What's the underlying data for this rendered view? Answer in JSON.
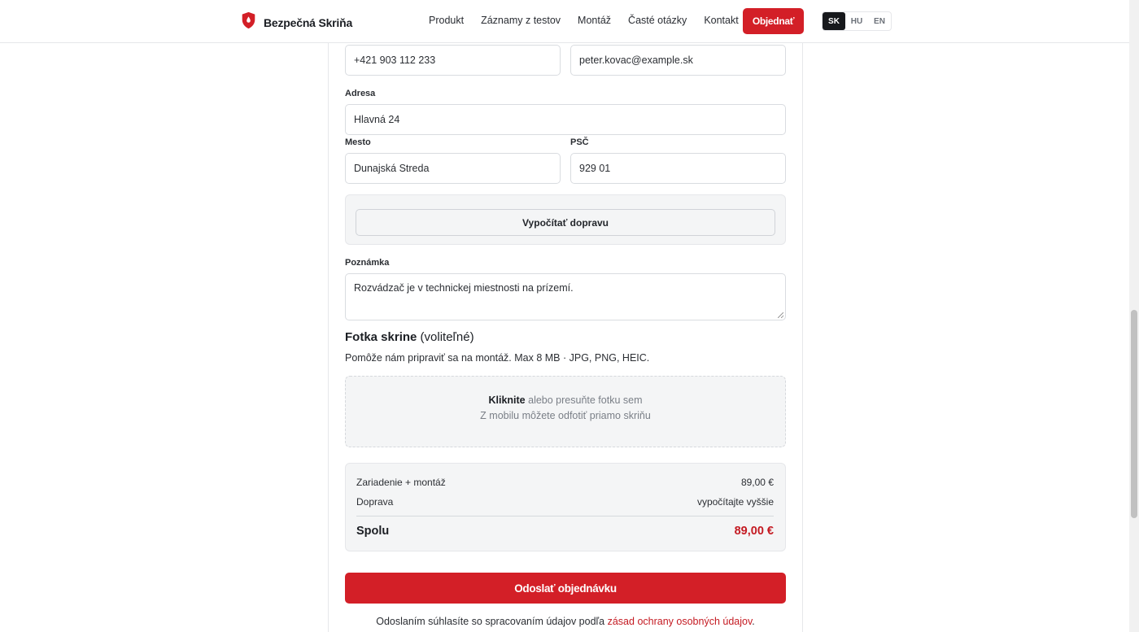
{
  "header": {
    "brand": "Bezpečná Skriňa",
    "nav": [
      "Produkt",
      "Záznamy z testov",
      "Montáž",
      "Časté otázky",
      "Kontakt"
    ],
    "order_button": "Objednať",
    "languages": [
      "SK",
      "HU",
      "EN"
    ],
    "active_language": "SK",
    "brand_color": "#d31f27"
  },
  "form": {
    "phone": "+421 903 112 233",
    "email": "peter.kovac@example.sk",
    "address_label": "Adresa",
    "address": "Hlavná 24",
    "city_label": "Mesto",
    "city": "Dunajská Streda",
    "zip_label": "PSČ",
    "zip": "929 01",
    "calc_shipping_button": "Vypočítať dopravu",
    "note_label": "Poznámka",
    "note": "Rozvádzač je v technickej miestnosti na prízemí."
  },
  "photo": {
    "title_bold": "Fotka skrine",
    "title_optional": "(voliteľné)",
    "description": "Pomôže nám pripraviť sa na montáž. Max 8 MB · JPG, PNG, HEIC.",
    "drop_click": "Kliknite",
    "drop_text": "alebo presuňte fotku sem",
    "drop_mobile": "Z mobilu môžete odfotiť priamo skriňu"
  },
  "summary": {
    "device_label": "Zariadenie + montáž",
    "device_price": "89,00 €",
    "shipping_label": "Doprava",
    "shipping_value": "vypočítajte vyššie",
    "total_label": "Spolu",
    "total_value": "89,00 €"
  },
  "submit_button": "Odoslať objednávku",
  "consent": {
    "text": "Odoslaním súhlasíte so spracovaním údajov podľa",
    "link": "zásad ochrany osobných údajov",
    "end": "."
  }
}
